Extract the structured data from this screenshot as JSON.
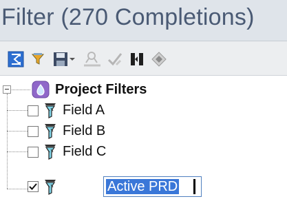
{
  "panel": {
    "title": "Filter (270 Completions)"
  },
  "toolbar": {
    "buttons": [
      {
        "icon": "sigma-icon"
      },
      {
        "icon": "funnel-icon"
      },
      {
        "icon": "save-icon"
      },
      {
        "icon": "dropdown-arrow-icon"
      },
      {
        "icon": "apply-filter-icon"
      },
      {
        "icon": "checkmark-pen-icon"
      },
      {
        "icon": "split-columns-icon"
      },
      {
        "icon": "diamond-icon"
      }
    ]
  },
  "tree": {
    "root_label": "Project Filters",
    "items": [
      {
        "label": "Field A",
        "checked": false
      },
      {
        "label": "Field B",
        "checked": false
      },
      {
        "label": "Field C",
        "checked": false
      },
      {
        "label": "Active PRD",
        "checked": true,
        "editing": true
      }
    ]
  },
  "colors": {
    "title_bg": "#dfe4ea",
    "title_text": "#4a5a74",
    "selection": "#3a77d8"
  }
}
